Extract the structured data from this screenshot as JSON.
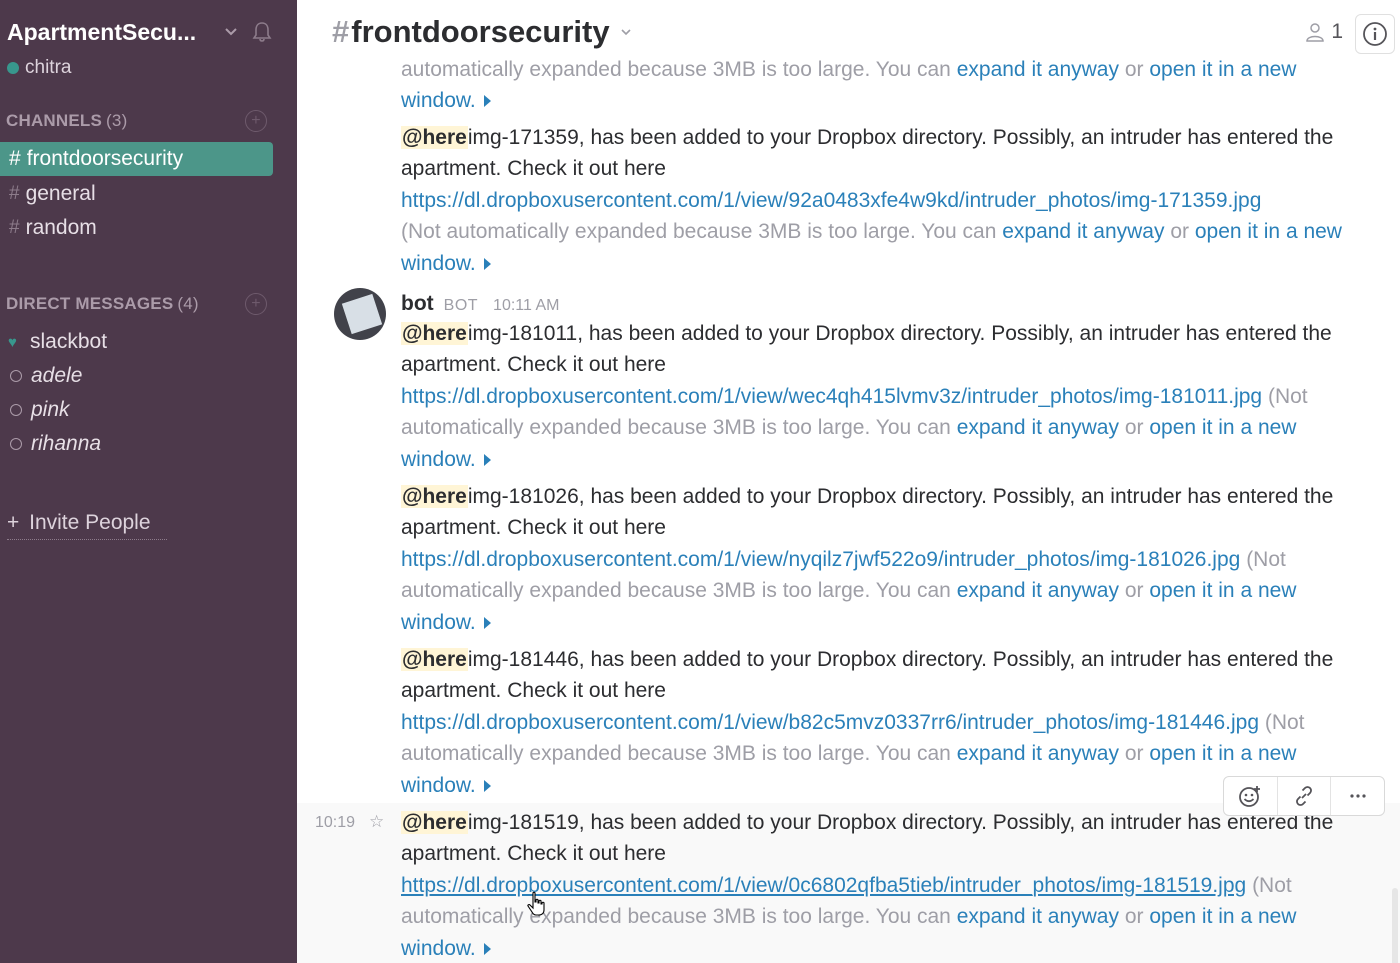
{
  "sidebar": {
    "team_name": "ApartmentSecu...",
    "user_name": "chitra",
    "channels_header": "CHANNELS",
    "channels_count": "(3)",
    "channels": [
      {
        "label": "frontdoorsecurity",
        "active": true
      },
      {
        "label": "general",
        "active": false
      },
      {
        "label": "random",
        "active": false
      }
    ],
    "dm_header": "DIRECT MESSAGES",
    "dm_count": "(4)",
    "dms": [
      {
        "label": "slackbot",
        "icon": "heart-icon"
      },
      {
        "label": "adele",
        "icon": "status-away-icon"
      },
      {
        "label": "pink",
        "icon": "status-away-icon"
      },
      {
        "label": "rihanna",
        "icon": "status-away-icon"
      }
    ],
    "invite_label": "Invite People",
    "plus_glyph": "+"
  },
  "header": {
    "hash": "#",
    "channel_name": "frontdoorsecurity",
    "member_count": "1"
  },
  "colors": {
    "sidebar_bg": "#4d394b",
    "active_channel": "#4c9689",
    "link": "#2a80b9",
    "mention_bg": "#fff5d6"
  },
  "common": {
    "mention": "@here",
    "msg_middle": "has been added to your Dropbox directory. Possibly, an intruder has entered the",
    "msg_line2": "apartment.  Check it out here",
    "not_expanded_open": "(Not",
    "automatically": "automatically expanded because 3MB is too large. You can",
    "not_automatically": "(Not automatically expanded because 3MB is too large. You can",
    "expand": "expand it anyway",
    "or": "or",
    "open_new": "open it in a new",
    "window": "window."
  },
  "top_partial": {
    "line1_prefix": "automatically expanded because 3MB is too large. You can"
  },
  "messages": [
    {
      "img": "img-171359,",
      "url": "https://dl.dropboxusercontent.com/1/view/92a0483xfe4w9kd/intruder_photos/img-171359.jpg"
    },
    {
      "img": "img-181011,",
      "url": "https://dl.dropboxusercontent.com/1/view/wec4qh415lvmv3z/intruder_photos/img-181011.jpg"
    },
    {
      "img": "img-181026,",
      "url": "https://dl.dropboxusercontent.com/1/view/nyqilz7jwf522o9/intruder_photos/img-181026.jpg"
    },
    {
      "img": "img-181446,",
      "url": "https://dl.dropboxusercontent.com/1/view/b82c5mvz0337rr6/intruder_photos/img-181446.jpg"
    },
    {
      "img": "img-181519,",
      "url": "https://dl.dropboxusercontent.com/1/view/0c6802qfba5tieb/intruder_photos/img-181519.jpg"
    }
  ],
  "sender": {
    "name": "bot",
    "tag": "BOT",
    "time": "10:11 AM"
  },
  "hover_time": "10:19"
}
